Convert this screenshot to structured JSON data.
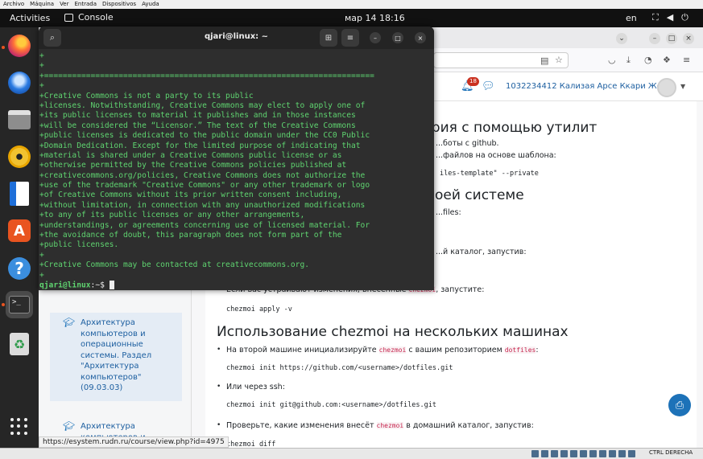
{
  "vbox_menu": [
    "Archivo",
    "Máquina",
    "Ver",
    "Entrada",
    "Dispositivos",
    "Ayuda"
  ],
  "topbar": {
    "activities": "Activities",
    "app_name": "Console",
    "clock": "мар 14  18:16",
    "lang": "en"
  },
  "dock": {
    "items": [
      "firefox-icon",
      "thunderbird-icon",
      "files-icon",
      "rhythmbox-icon",
      "writer-icon",
      "app-center-icon",
      "help-icon",
      "terminal-icon",
      "trash-icon",
      "show-apps-icon"
    ],
    "running_dot_color": "#e95420"
  },
  "browser": {
    "notification_count": "18",
    "username": "1032234412 Кализая Арсе Ккари Жекка",
    "course_index": [
      {
        "label": "Архитектура компьютеров и операционные системы. Раздел \"Архитектура компьютеров\" (09.03.03)"
      },
      {
        "label": "Архитектура компьютеров и операционные системы. Раздел"
      }
    ],
    "status_url": "https://esystem.rudn.ru/course/view.php?id=4975",
    "content": {
      "h_repo": "...ктория с помощью утилит",
      "p_github": "...боты с github.",
      "p_template": "...файлов на основе шаблона:",
      "code_template": "iles-template\" --private",
      "h_system": "...в своей системе",
      "p_files": "...files:",
      "p_diff_catalog": "...й каталог, запустив:",
      "p_if_changes_prefix": "Если вас устраивают изменения, внесённые ",
      "p_if_changes_kw": "chezmoi",
      "p_if_changes_suffix": ", запустите:",
      "code_apply": "chezmoi apply -v",
      "h_multi": "Использование chezmoi на нескольких машинах",
      "p_second_prefix": "На второй машине инициализируйте ",
      "p_second_kw": "chezmoi",
      "p_second_mid": " с вашим репозиторием ",
      "p_second_kw2": "dotfiles",
      "p_second_suffix": ":",
      "code_init_https": "chezmoi init https://github.com/<username>/dotfiles.git",
      "p_ssh": "Или через ssh:",
      "code_init_ssh": "chezmoi init git@github.com:<username>/dotfiles.git",
      "p_check_prefix": "Проверьте, какие изменения внесёт ",
      "p_check_kw": "chezmoi",
      "p_check_suffix": " в домашний каталог, запустив:",
      "code_diff": "chezmoi diff"
    }
  },
  "terminal": {
    "title": "qjari@linux: ~",
    "lines": [
      "+",
      "+",
      "+=======================================================================",
      "+",
      "+Creative Commons is not a party to its public",
      "+licenses. Notwithstanding, Creative Commons may elect to apply one of",
      "+its public licenses to material it publishes and in those instances",
      "+will be considered the “Licensor.” The text of the Creative Commons",
      "+public licenses is dedicated to the public domain under the CC0 Public",
      "+Domain Dedication. Except for the limited purpose of indicating that",
      "+material is shared under a Creative Commons public license or as",
      "+otherwise permitted by the Creative Commons policies published at",
      "+creativecommons.org/policies, Creative Commons does not authorize the",
      "+use of the trademark \"Creative Commons\" or any other trademark or logo",
      "+of Creative Commons without its prior written consent including,",
      "+without limitation, in connection with any unauthorized modifications",
      "+to any of its public licenses or any other arrangements,",
      "+understandings, or agreements concerning use of licensed material. For",
      "+the avoidance of doubt, this paragraph does not form part of the",
      "+public licenses.",
      "+",
      "+Creative Commons may be contacted at creativecommons.org.",
      "+"
    ],
    "prompt_user": "qjari@linux",
    "prompt_rest": ":~$ ",
    "text_color": "#5fd470"
  },
  "vm_status": {
    "host_key": "CTRL DERECHA"
  }
}
